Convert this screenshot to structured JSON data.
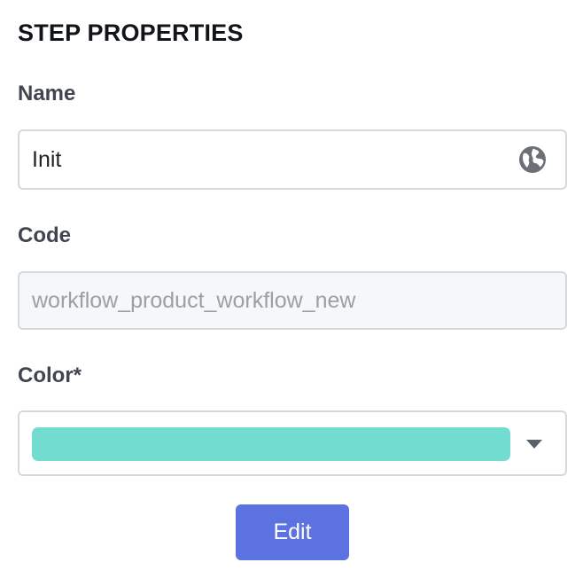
{
  "panel": {
    "title": "STEP PROPERTIES"
  },
  "name_field": {
    "label": "Name",
    "value": "Init",
    "icon": "globe-icon"
  },
  "code_field": {
    "label": "Code",
    "placeholder": "workflow_product_workflow_new",
    "value": ""
  },
  "color_field": {
    "label": "Color*",
    "selected_color": "#72dcd0",
    "icon": "chevron-down-icon"
  },
  "actions": {
    "edit_label": "Edit"
  },
  "theme": {
    "accent": "#5b72e0",
    "border": "#d5d8dc",
    "disabled_bg": "#f6f7f9",
    "icon_color": "#6b7077"
  }
}
